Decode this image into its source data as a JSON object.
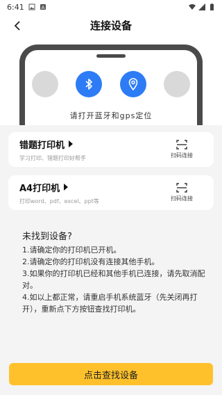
{
  "status_bar": {
    "time": "6:41"
  },
  "header": {
    "title": "连接设备"
  },
  "top_area": {
    "hint": "请打开蓝牙和gps定位"
  },
  "cards": [
    {
      "title": "错题打印机",
      "subtitle": "学习打印、错题打印好帮手",
      "scan_label": "扫码连接"
    },
    {
      "title": "A4打印机",
      "subtitle": "打印word、pdf、excel、ppt等",
      "scan_label": "扫码连接"
    }
  ],
  "tips": {
    "title": "未找到设备?",
    "lines": [
      "1.请确定你的打印机已开机。",
      "2.请确定你的打印机没有连接其他手机。",
      "3.如果你的打印机已经和其他手机已连接，请先取消配对。",
      "4.如以上都正常，请重启手机系统蓝牙（先关闭再打开），重新点下方按钮查找打印机。"
    ]
  },
  "find_button": {
    "label": "点击查找设备"
  },
  "colors": {
    "accent_yellow": "#ffc12b",
    "bluetooth_blue": "#2d7cf6"
  }
}
